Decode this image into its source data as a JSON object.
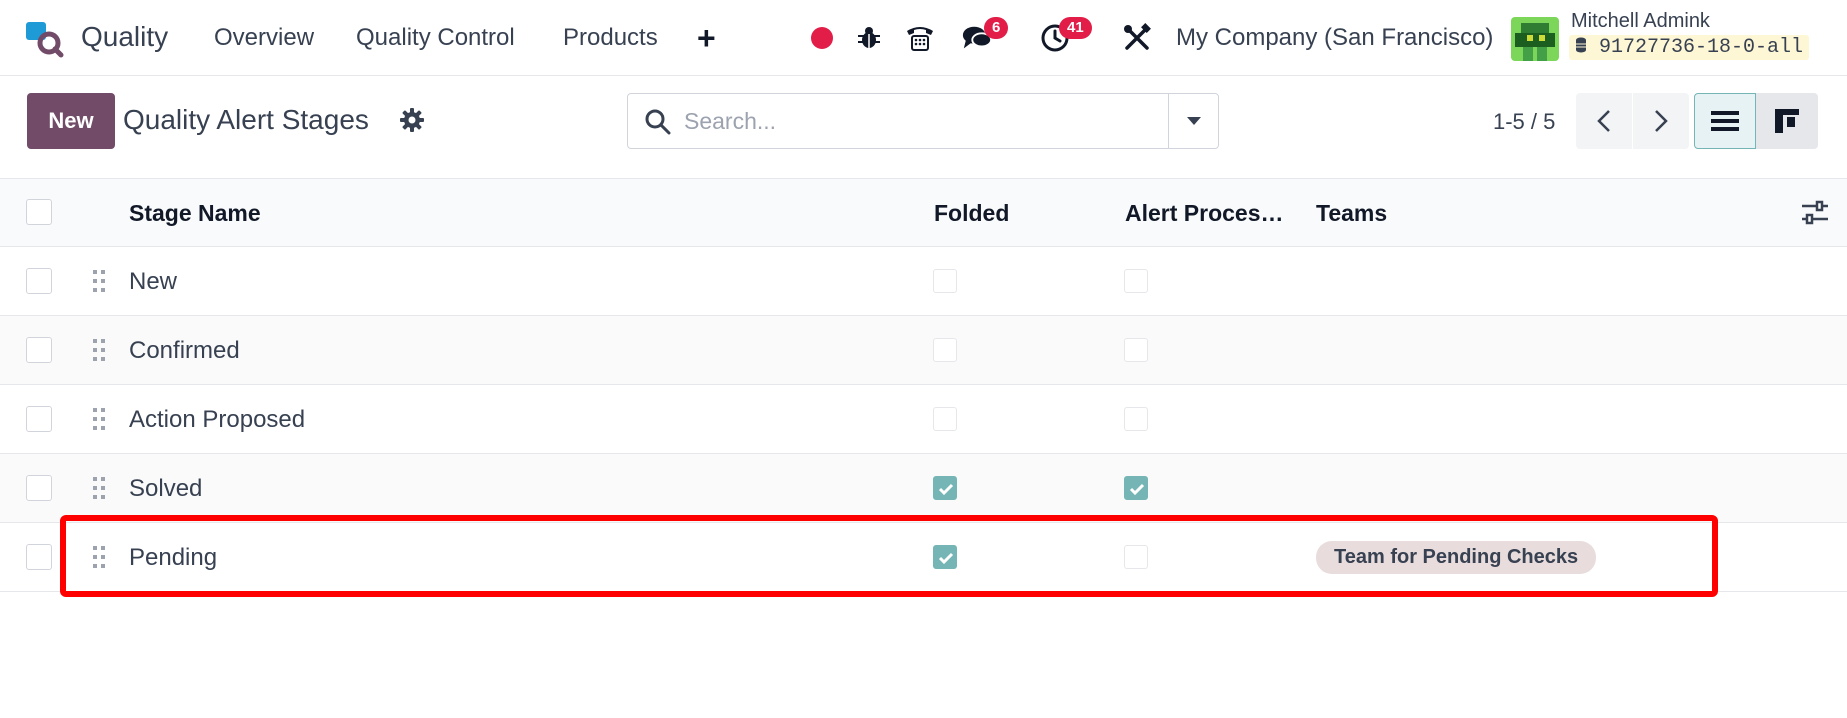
{
  "app": {
    "title": "Quality"
  },
  "nav": {
    "menu": [
      "Overview",
      "Quality Control",
      "Products"
    ],
    "plus": "+",
    "messages_badge": "6",
    "activities_badge": "41",
    "company": "My Company (San Francisco)",
    "user_name": "Mitchell Admink",
    "database": "91727736-18-0-all"
  },
  "control": {
    "new_label": "New",
    "title": "Quality Alert Stages",
    "search_placeholder": "Search...",
    "pager": "1-5 / 5"
  },
  "table": {
    "columns": [
      "Stage Name",
      "Folded",
      "Alert Proces…",
      "Teams"
    ],
    "rows": [
      {
        "name": "New",
        "folded": false,
        "alert_processed": false,
        "team": ""
      },
      {
        "name": "Confirmed",
        "folded": false,
        "alert_processed": false,
        "team": ""
      },
      {
        "name": "Action Proposed",
        "folded": false,
        "alert_processed": false,
        "team": ""
      },
      {
        "name": "Solved",
        "folded": true,
        "alert_processed": true,
        "team": ""
      },
      {
        "name": "Pending",
        "folded": true,
        "alert_processed": false,
        "team": "Team for Pending Checks"
      }
    ]
  },
  "colors": {
    "brand": "#714b67",
    "checked": "#76b5b5",
    "badge": "#e11d48",
    "highlight": "#ff0000"
  },
  "icons": [
    "app-logo-icon",
    "record-icon",
    "bug-icon",
    "phone-icon",
    "chat-icon",
    "clock-icon",
    "tools-icon",
    "database-icon",
    "gear-icon",
    "search-icon",
    "caret-down-icon",
    "chevron-left-icon",
    "chevron-right-icon",
    "list-view-icon",
    "kanban-view-icon",
    "column-settings-icon",
    "drag-handle-icon"
  ]
}
